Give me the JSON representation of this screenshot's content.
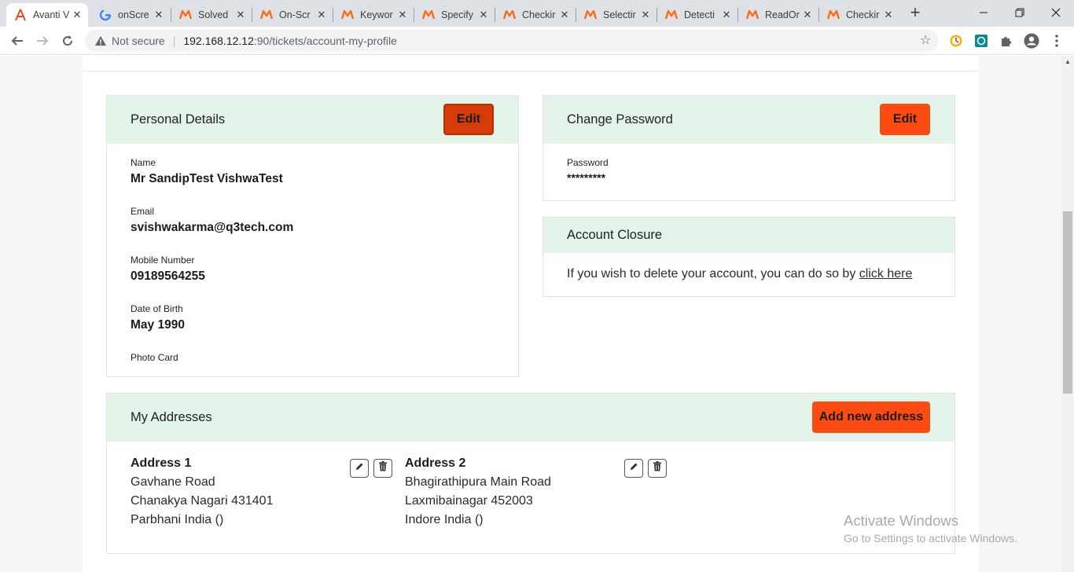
{
  "browser": {
    "tabs": [
      {
        "label": "Avanti V",
        "icon": "avanti-logo-icon"
      },
      {
        "label": "onScre",
        "icon": "google-icon"
      },
      {
        "label": "Solved",
        "icon": "katalon-icon"
      },
      {
        "label": "On-Scr",
        "icon": "katalon-icon"
      },
      {
        "label": "Keywor",
        "icon": "katalon-icon"
      },
      {
        "label": "Specify",
        "icon": "katalon-icon"
      },
      {
        "label": "Checkir",
        "icon": "katalon-icon"
      },
      {
        "label": "Selectir",
        "icon": "katalon-icon"
      },
      {
        "label": "Detecti",
        "icon": "katalon-icon"
      },
      {
        "label": "ReadOr",
        "icon": "katalon-icon"
      },
      {
        "label": "Checkir",
        "icon": "katalon-icon"
      }
    ],
    "tab_close_glyph": "✕",
    "new_tab_glyph": "+",
    "security_label": "Not secure",
    "url_host": "192.168.12.12",
    "url_path": ":90/tickets/account-my-profile"
  },
  "personal_details": {
    "title": "Personal Details",
    "edit_label": "Edit",
    "fields": [
      {
        "label": "Name",
        "value": "Mr SandipTest VishwaTest"
      },
      {
        "label": "Email",
        "value": "svishwakarma@q3tech.com"
      },
      {
        "label": "Mobile Number",
        "value": "09189564255"
      },
      {
        "label": "Date of Birth",
        "value": "May 1990"
      },
      {
        "label": "Photo Card",
        "value": ""
      }
    ]
  },
  "change_password": {
    "title": "Change Password",
    "edit_label": "Edit",
    "field_label": "Password",
    "field_value": "*********"
  },
  "account_closure": {
    "title": "Account Closure",
    "text": "If you wish to delete your account, you can do so by",
    "link_label": "click here"
  },
  "addresses": {
    "title": "My Addresses",
    "add_label": "Add new address",
    "items": [
      {
        "title": "Address 1",
        "line1": "Gavhane Road",
        "line2": "Chanakya Nagari 431401",
        "line3": "Parbhani India ()"
      },
      {
        "title": "Address 2",
        "line1": "Bhagirathipura Main Road",
        "line2": "Laxmibainagar 452003",
        "line3": "Indore India ()"
      }
    ]
  },
  "watermark": {
    "line1": "Activate Windows",
    "line2": "Go to Settings to activate Windows."
  },
  "colors": {
    "accent": "#fd4b12",
    "header_bg": "#e2f5e8"
  }
}
